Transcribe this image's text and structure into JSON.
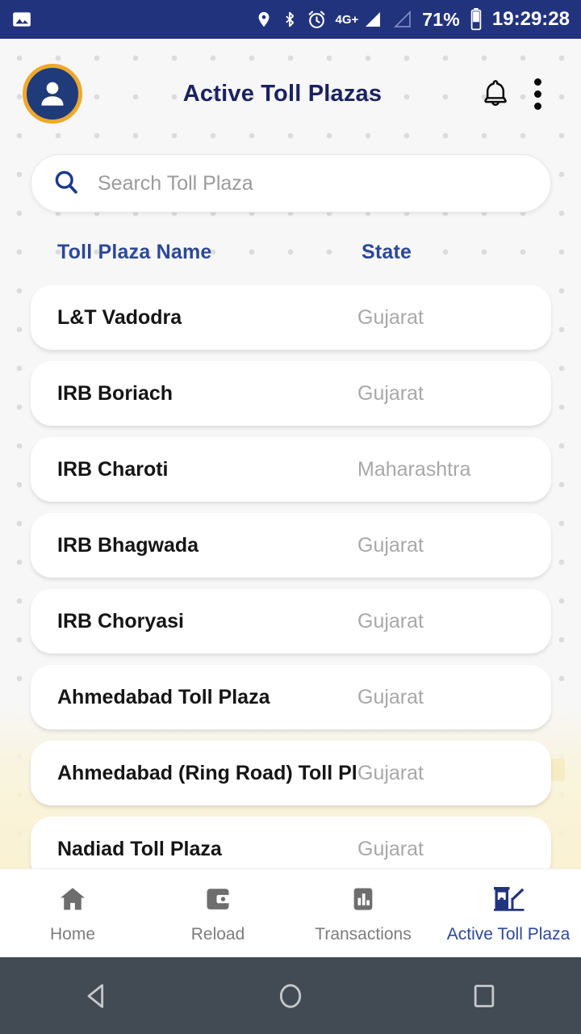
{
  "statusbar": {
    "left_icon": "image-icon",
    "icons": [
      "location-pin-icon",
      "bluetooth-icon",
      "alarm-clock-icon"
    ],
    "network_label": "4G+",
    "signal_primary": "signal-bars-full-icon",
    "signal_secondary": "signal-bars-empty-icon",
    "battery_percent": "71%",
    "battery_icon": "battery-icon",
    "clock": "19:29:28",
    "background_color": "#22337e"
  },
  "header": {
    "avatar_icon": "user-avatar-icon",
    "title": "Active Toll Plazas",
    "notification_icon": "bell-icon",
    "overflow_icon": "more-vertical-icon",
    "title_color": "#1b2260",
    "avatar_ring_color": "#f0a82a"
  },
  "search": {
    "icon": "search-icon",
    "placeholder": "Search Toll Plaza",
    "value": ""
  },
  "table": {
    "columns": [
      "Toll Plaza Name",
      "State"
    ],
    "header_color": "#2d4898",
    "rows": [
      {
        "name": "L&T Vadodra",
        "state": "Gujarat"
      },
      {
        "name": "IRB Boriach",
        "state": "Gujarat"
      },
      {
        "name": "IRB Charoti",
        "state": "Maharashtra"
      },
      {
        "name": "IRB Bhagwada",
        "state": "Gujarat"
      },
      {
        "name": "IRB Choryasi",
        "state": "Gujarat"
      },
      {
        "name": "Ahmedabad Toll Plaza",
        "state": "Gujarat"
      },
      {
        "name": "Ahmedabad (Ring Road) Toll Plaza",
        "state": "Gujarat"
      },
      {
        "name": "Nadiad Toll Plaza",
        "state": "Gujarat"
      }
    ]
  },
  "bottom_nav": {
    "active_index": 3,
    "active_color": "#2d4898",
    "inactive_color": "#7d7d7d",
    "items": [
      {
        "label": "Home",
        "icon": "home-icon"
      },
      {
        "label": "Reload",
        "icon": "wallet-icon"
      },
      {
        "label": "Transactions",
        "icon": "bar-chart-icon"
      },
      {
        "label": "Active Toll Plaza",
        "icon": "toll-booth-icon"
      }
    ]
  },
  "android_nav": {
    "back": "back-triangle-icon",
    "home": "home-circle-icon",
    "recents": "recents-square-icon"
  }
}
